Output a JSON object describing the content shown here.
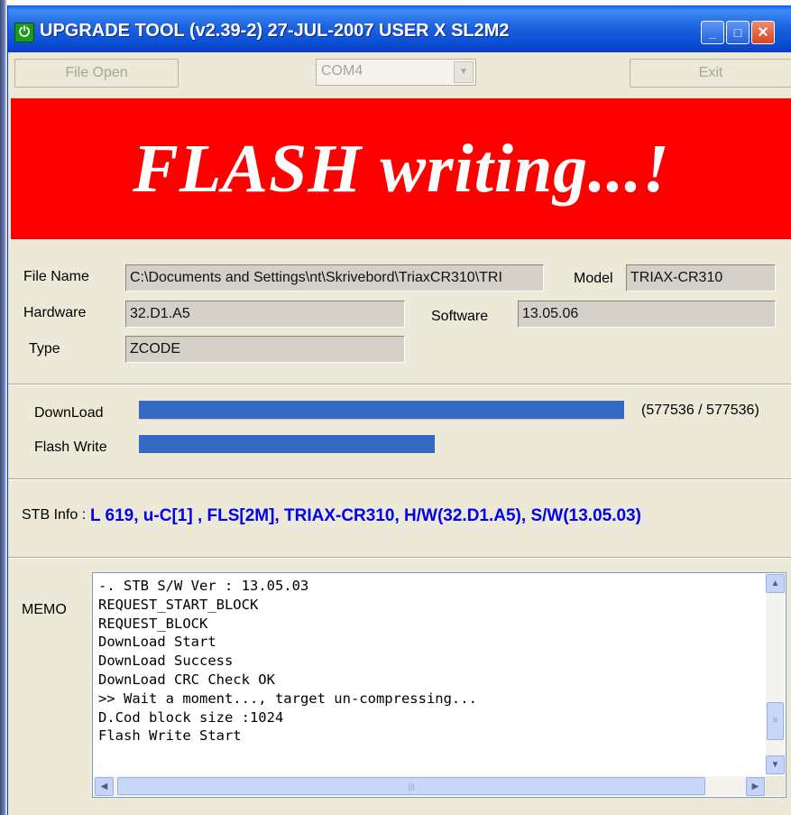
{
  "window": {
    "title": "UPGRADE TOOL (v2.39-2) 27-JUL-2007 USER X SL2M2",
    "app_icon": "power-icon",
    "controls": {
      "minimize": "minimize-icon",
      "maximize": "maximize-icon",
      "close": "close-icon"
    }
  },
  "toolbar": {
    "file_open_label": "File Open",
    "port_value": "COM4",
    "exit_label": "Exit"
  },
  "banner": {
    "text": "FLASH writing...!",
    "background_color": "#ff0000",
    "text_color": "#ffffff"
  },
  "info": {
    "file_name_label": "File Name",
    "file_name_value": "C:\\Documents and Settings\\nt\\Skrivebord\\TriaxCR310\\TRI",
    "model_label": "Model",
    "model_value": "TRIAX-CR310",
    "hardware_label": "Hardware",
    "hardware_value": "32.D1.A5",
    "software_label": "Software",
    "software_value": "13.05.06",
    "type_label": "Type",
    "type_value": "ZCODE"
  },
  "progress": {
    "download_label": "DownLoad",
    "download_fraction": 1.0,
    "download_count": "(577536 / 577536)",
    "flash_write_label": "Flash Write",
    "flash_write_fraction": 0.61,
    "bar_color": "#3469c3"
  },
  "stb": {
    "label": "STB Info :",
    "value": "L 619, u-C[1] , FLS[2M], TRIAX-CR310, H/W(32.D1.A5), S/W(13.05.03)",
    "value_color": "#0000ee"
  },
  "memo": {
    "label": "MEMO",
    "lines": [
      "-. STB S/W Ver : 13.05.03",
      "REQUEST_START_BLOCK",
      "REQUEST_BLOCK",
      "DownLoad Start",
      "DownLoad Success",
      "DownLoad CRC Check OK",
      ">> Wait a moment..., target un-compressing...",
      "D.Cod block size :1024",
      "Flash Write Start"
    ]
  }
}
